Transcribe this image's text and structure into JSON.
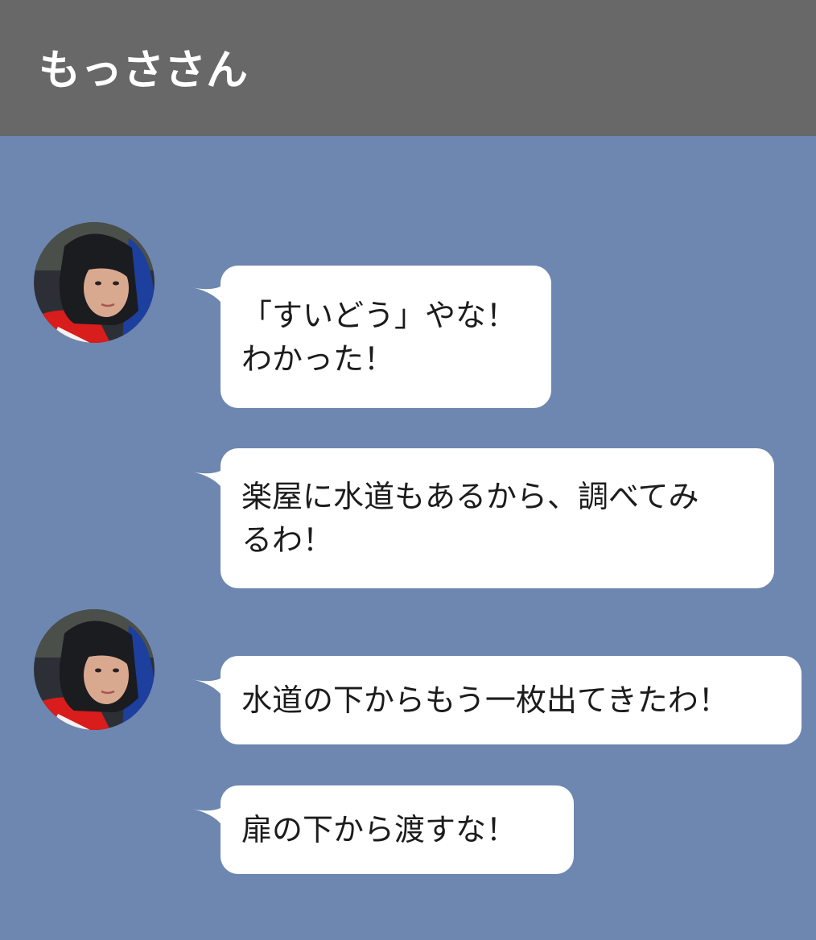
{
  "header": {
    "title": "もっささん"
  },
  "messages": [
    {
      "text": "「すいどう」やな！\nわかった！",
      "show_avatar": true
    },
    {
      "text": "楽屋に水道もあるから、調べてみ\nるわ！",
      "show_avatar": false
    },
    {
      "text": "水道の下からもう一枚出てきたわ！",
      "show_avatar": true
    },
    {
      "text": "扉の下から渡すな！",
      "show_avatar": false
    }
  ],
  "colors": {
    "header_bg": "#676867",
    "chat_bg": "#6e87b0",
    "bubble_bg": "#ffffff",
    "text": "#1c1c1c"
  }
}
